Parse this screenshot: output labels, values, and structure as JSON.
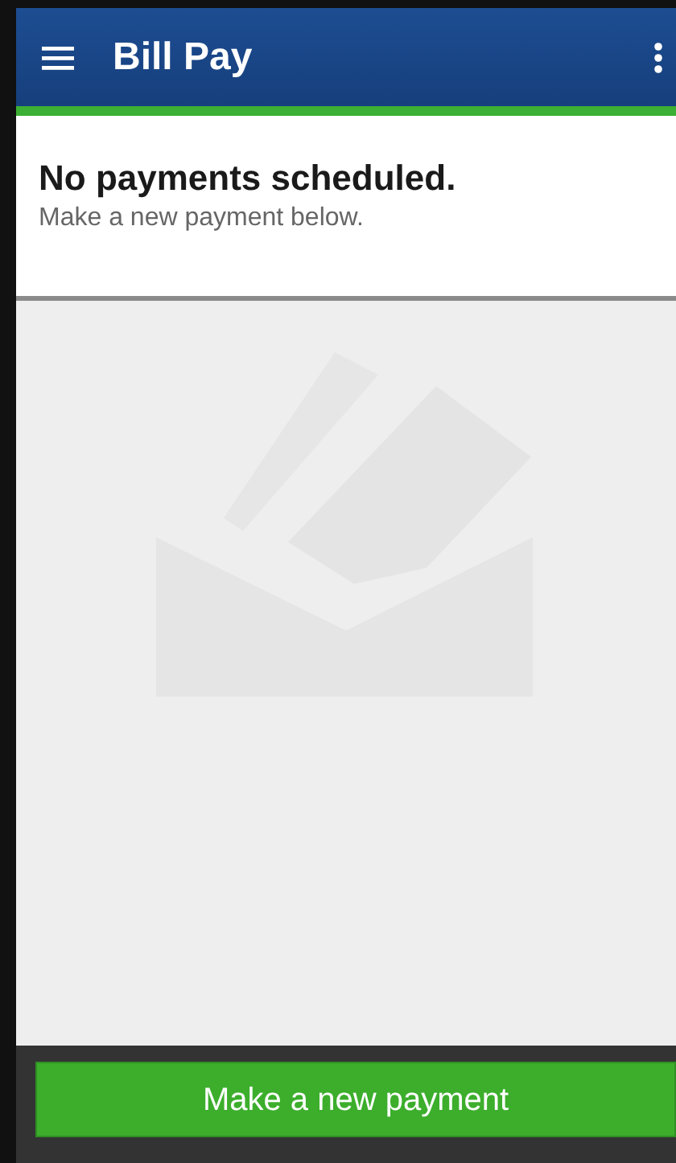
{
  "app_bar": {
    "title": "Bill Pay"
  },
  "empty_state": {
    "heading": "No payments scheduled.",
    "message": "Make a new payment below."
  },
  "footer": {
    "button": "Make a new payment"
  }
}
